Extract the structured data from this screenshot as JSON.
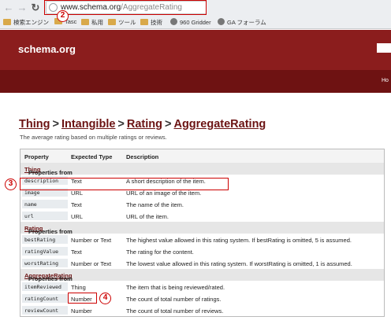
{
  "browser": {
    "url_host": "www.schema.org",
    "url_path": "/AggregateRating",
    "bookmarks": [
      {
        "label": "検索エンジン"
      },
      {
        "label": "Tasc"
      },
      {
        "label": "私用"
      },
      {
        "label": "ツール"
      },
      {
        "label": "技術"
      },
      {
        "label": "960 Gridder"
      },
      {
        "label": "GA フォーラム"
      }
    ]
  },
  "callouts": [
    "2",
    "3",
    "4"
  ],
  "site": {
    "logo": "schema.org",
    "nav_home": "Ho"
  },
  "breadcrumb": {
    "items": [
      "Thing",
      "Intangible",
      "Rating",
      "AggregateRating"
    ],
    "separator": ">"
  },
  "description": "The average rating based on multiple ratings or reviews.",
  "table": {
    "headers": [
      "Property",
      "Expected Type",
      "Description"
    ],
    "sections": [
      {
        "prefix": "Properties from ",
        "source": "Thing",
        "rows": [
          {
            "property": "description",
            "type": "Text",
            "description": "A short description of the item."
          },
          {
            "property": "image",
            "type": "URL",
            "description": "URL of an image of the item."
          },
          {
            "property": "name",
            "type": "Text",
            "description": "The name of the item."
          },
          {
            "property": "url",
            "type": "URL",
            "description": "URL of the item."
          }
        ]
      },
      {
        "prefix": "Properties from ",
        "source": "Rating",
        "rows": [
          {
            "property": "bestRating",
            "type": "Number or Text",
            "description": "The highest value allowed in this rating system. If bestRating is omitted, 5 is assumed."
          },
          {
            "property": "ratingValue",
            "type": "Text",
            "description": "The rating for the content."
          },
          {
            "property": "worstRating",
            "type": "Number or Text",
            "description": "The lowest value allowed in this rating system. If worstRating is omitted, 1 is assumed."
          }
        ]
      },
      {
        "prefix": "Properties from ",
        "source": "AggregateRating",
        "rows": [
          {
            "property": "itemReviewed",
            "type": "Thing",
            "description": "The item that is being reviewed/rated."
          },
          {
            "property": "ratingCount",
            "type": "Number",
            "description": "The count of total number of ratings."
          },
          {
            "property": "reviewCount",
            "type": "Number",
            "description": "The count of total number of reviews."
          }
        ]
      }
    ]
  },
  "colors": {
    "header_bg": "#8b1d1d",
    "nav_bg": "#6e1212",
    "link": "#6b1313",
    "callout": "#cc0000"
  }
}
